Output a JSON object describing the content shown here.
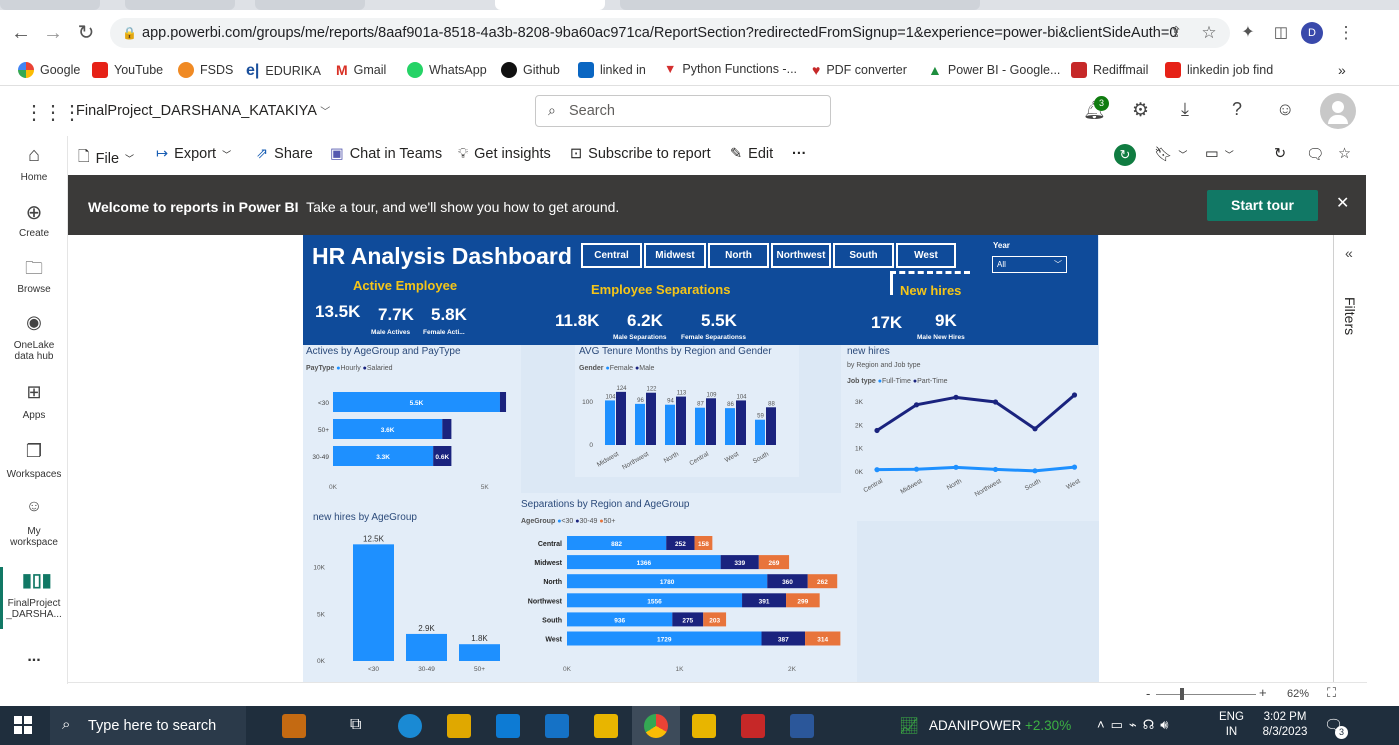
{
  "browser": {
    "url": "app.powerbi.com/groups/me/reports/8aaf901a-8518-4a3b-8208-9ba60ac971ca/ReportSection?redirectedFromSignup=1&experience=power-bi&clientSideAuth=0",
    "profile_initial": "D",
    "bookmarks": [
      "Google",
      "YouTube",
      "FSDS",
      "EDURIKA",
      "Gmail",
      "WhatsApp",
      "Github",
      "linked in",
      "Python Functions -...",
      "PDF converter",
      "Power BI - Google...",
      "Rediffmail",
      "linkedin job find"
    ],
    "more": "»"
  },
  "pbi": {
    "workspace_title": "FinalProject_DARSHANA_KATAKIYA",
    "search_placeholder": "Search",
    "notification_count": "3",
    "nav": [
      "Home",
      "Create",
      "Browse",
      "OneLake data hub",
      "Apps",
      "Workspaces",
      "My workspace",
      "FinalProject _DARSHA...",
      "..."
    ],
    "toolbar": {
      "file": "File",
      "export": "Export",
      "share": "Share",
      "chat": "Chat in Teams",
      "insights": "Get insights",
      "subscribe": "Subscribe to report",
      "edit": "Edit",
      "more": "···"
    },
    "banner": {
      "bold": "Welcome to reports in Power BI",
      "text": "Take a tour, and we'll show you how to get around.",
      "button": "Start tour",
      "close": "✕"
    },
    "filters_label": "Filters",
    "zoom": "62%",
    "zoom_minus": "-",
    "zoom_plus": "+"
  },
  "report": {
    "title": "HR Analysis Dashboard",
    "regions": [
      "Central",
      "Midwest",
      "North",
      "Northwest",
      "South",
      "West"
    ],
    "year_label": "Year",
    "year_value": "All",
    "active": {
      "heading": "Active Employee",
      "total": "13.5K",
      "male": "7.7K",
      "male_label": "Male Actives",
      "female": "5.8K",
      "female_label": "Female Acti..."
    },
    "separations": {
      "heading": "Employee Separations",
      "total": "11.8K",
      "male": "6.2K",
      "male_label": "Male Separations",
      "female": "5.5K",
      "female_label": "Female Separationss"
    },
    "newhires": {
      "heading": "New hires",
      "total": "17K",
      "male": "9K",
      "male_label": "Male New Hires"
    },
    "colors": {
      "header": "#0f4b9a",
      "light": "#1e90ff",
      "dark": "#1a237e",
      "orange": "#e8743b",
      "accent": "#f5c518"
    }
  },
  "charts": {
    "actives": {
      "title": "Actives by AgeGroup and PayType",
      "legend_title": "PayType",
      "legend": [
        "Hourly",
        "Salaried"
      ],
      "chart_data": {
        "type": "bar",
        "orientation": "horizontal",
        "stacked": true,
        "categories": [
          "<30",
          "50+",
          "30-49"
        ],
        "series": [
          {
            "name": "Hourly",
            "values": [
              5500,
              3600,
              3300
            ],
            "labels": [
              "5.5K",
              "3.6K",
              "3.3K"
            ]
          },
          {
            "name": "Salaried",
            "values": [
              200,
              300,
              600
            ],
            "labels": [
              "",
              "",
              "0.6K"
            ]
          }
        ],
        "xticks": [
          "0K",
          "5K"
        ],
        "xlim": [
          0,
          5600
        ]
      }
    },
    "tenure": {
      "title": "AVG Tenure Months by Region and Gender",
      "legend_title": "Gender",
      "legend": [
        "Female",
        "Male"
      ],
      "chart_data": {
        "type": "bar",
        "categories": [
          "Midwest",
          "Northwest",
          "North",
          "Central",
          "West",
          "South"
        ],
        "series": [
          {
            "name": "Female",
            "values": [
              104,
              96,
              94,
              87,
              86,
              59
            ]
          },
          {
            "name": "Male",
            "values": [
              124,
              122,
              113,
              109,
              104,
              88
            ]
          }
        ],
        "yticks": [
          "0",
          "100"
        ],
        "ylim": [
          0,
          140
        ]
      }
    },
    "newhires_line": {
      "title": "new hires",
      "subtitle": "by Region and Job type",
      "legend_title": "Job type",
      "legend": [
        "Full-Time",
        "Part-Time"
      ],
      "chart_data": {
        "type": "line",
        "categories": [
          "Central",
          "Midwest",
          "North",
          "Northwest",
          "South",
          "West"
        ],
        "series": [
          {
            "name": "Full-Time",
            "values": [
              100,
              120,
              200,
              110,
              50,
              210
            ]
          },
          {
            "name": "Part-Time",
            "values": [
              1780,
              2880,
              3200,
              3000,
              1850,
              3300
            ]
          }
        ],
        "yticks": [
          "0K",
          "1K",
          "2K",
          "3K"
        ],
        "ylim": [
          0,
          3600
        ]
      }
    },
    "newhires_age": {
      "title": "new hires by AgeGroup",
      "chart_data": {
        "type": "bar",
        "categories": [
          "<30",
          "30-49",
          "50+"
        ],
        "values": [
          12500,
          2900,
          1800
        ],
        "labels": [
          "12.5K",
          "2.9K",
          "1.8K"
        ],
        "yticks": [
          "0K",
          "5K",
          "10K"
        ],
        "ylim": [
          0,
          13500
        ]
      }
    },
    "separations": {
      "title": "Separations by Region and AgeGroup",
      "legend_title": "AgeGroup",
      "legend": [
        "<30",
        "30-49",
        "50+"
      ],
      "chart_data": {
        "type": "bar",
        "orientation": "horizontal",
        "stacked": true,
        "categories": [
          "Central",
          "Midwest",
          "North",
          "Northwest",
          "South",
          "West"
        ],
        "series": [
          {
            "name": "<30",
            "values": [
              882,
              1366,
              1780,
              1556,
              936,
              1729
            ]
          },
          {
            "name": "30-49",
            "values": [
              252,
              339,
              360,
              391,
              275,
              387
            ]
          },
          {
            "name": "50+",
            "values": [
              158,
              269,
              262,
              299,
              203,
              314
            ]
          }
        ],
        "xticks": [
          "0K",
          "1K",
          "2K"
        ],
        "xlim": [
          0,
          2400
        ]
      }
    }
  },
  "taskbar": {
    "search": "Type here to search",
    "stock_name": "ADANIPOWER",
    "stock_change": "+2.30%",
    "lang1": "ENG",
    "lang2": "IN",
    "time": "3:02 PM",
    "date": "8/3/2023",
    "notif": "3"
  }
}
